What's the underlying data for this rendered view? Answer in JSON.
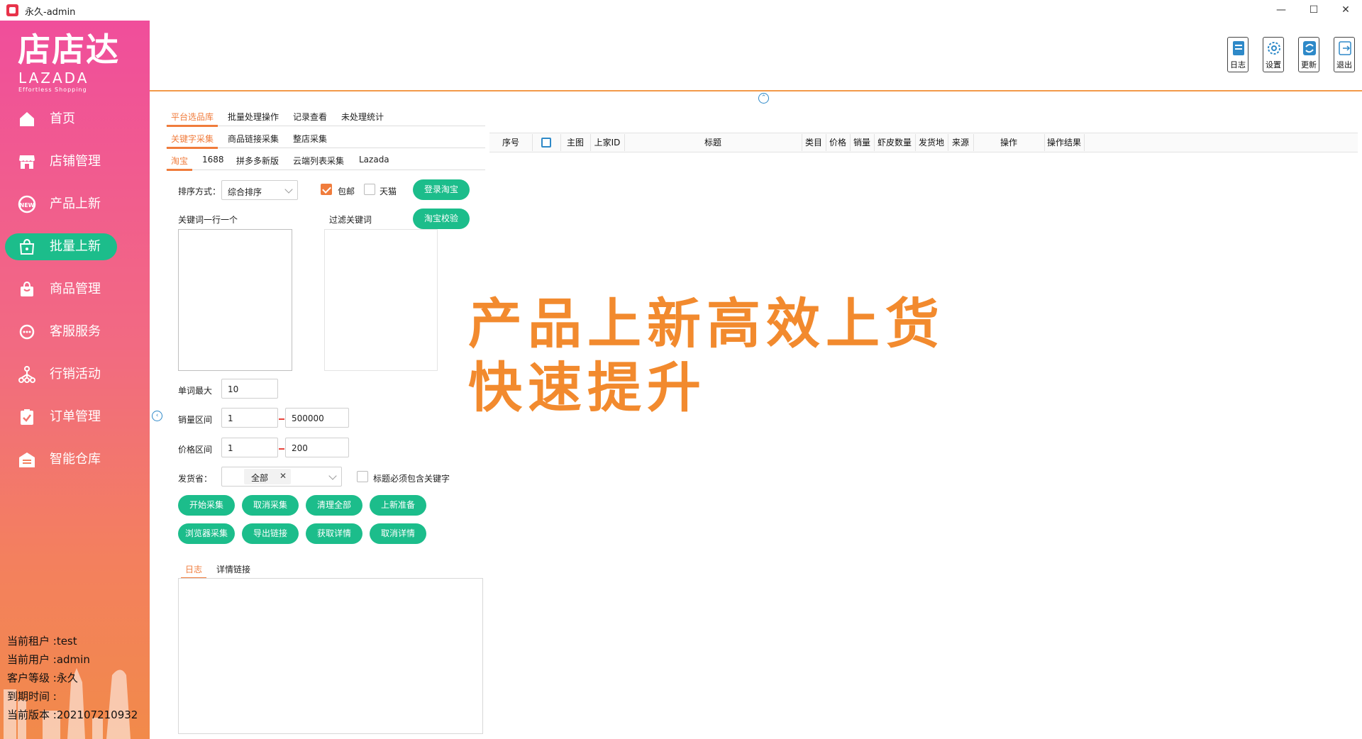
{
  "window": {
    "title": "永久-admin",
    "minimize": "—",
    "maximize": "☐",
    "close": "✕"
  },
  "brand": {
    "name": "店店达",
    "sub": "LAZADA",
    "tagline": "Effortless Shopping"
  },
  "sidebar": {
    "items": [
      {
        "label": "首页",
        "icon": "home-icon"
      },
      {
        "label": "店铺管理",
        "icon": "store-icon"
      },
      {
        "label": "产品上新",
        "icon": "new-badge-icon"
      },
      {
        "label": "批量上新",
        "icon": "bag-icon",
        "active": true
      },
      {
        "label": "商品管理",
        "icon": "shopping-bag-icon"
      },
      {
        "label": "客服服务",
        "icon": "support-icon"
      },
      {
        "label": "行销活动",
        "icon": "network-icon"
      },
      {
        "label": "订单管理",
        "icon": "clipboard-check-icon"
      },
      {
        "label": "智能仓库",
        "icon": "warehouse-icon"
      }
    ],
    "user": {
      "tenant": "当前租户 :test",
      "user": "当前用户 :admin",
      "level": "客户等级 :永久",
      "expiry": "到期时间 :",
      "version": "当前版本 :202107210932"
    }
  },
  "toolbar": {
    "log": "日志",
    "settings": "设置",
    "update": "更新",
    "logout": "退出"
  },
  "tabs": {
    "level1": [
      "平台选品库",
      "批量处理操作",
      "记录查看",
      "未处理统计"
    ],
    "level2": [
      "关键字采集",
      "商品链接采集",
      "整店采集"
    ],
    "level3": [
      "淘宝",
      "1688",
      "拼多多新版",
      "云端列表采集",
      "Lazada"
    ],
    "bottom": [
      "日志",
      "详情链接"
    ]
  },
  "form": {
    "sort_label": "排序方式：",
    "sort_value": "综合排序",
    "free_shipping": "包邮",
    "tmall": "天猫",
    "login_taobao": "登录淘宝",
    "keywords_label": "关键词一行一个",
    "filter_label": "过滤关键词",
    "taobao_verify": "淘宝校验",
    "max_label": "单词最大",
    "max_value": "10",
    "sales_label": "销量区间",
    "sales_min": "1",
    "sales_max": "500000",
    "price_label": "价格区间",
    "price_min": "1",
    "price_max": "200",
    "province_label": "发货省：",
    "province_value": "全部",
    "title_must": "标题必须包含关键字"
  },
  "buttons": {
    "row1": [
      "开始采集",
      "取消采集",
      "清理全部",
      "上新准备"
    ],
    "row2": [
      "浏览器采集",
      "导出链接",
      "获取详情",
      "取消详情"
    ]
  },
  "table": {
    "columns": [
      "序号",
      "",
      "主图",
      "上家ID",
      "标题",
      "类目",
      "价格",
      "销量",
      "虾皮数量",
      "发货地",
      "来源",
      "操作",
      "操作结果"
    ]
  },
  "promo": {
    "line1": "产品上新高效上货",
    "line2": "快速提升"
  },
  "colors": {
    "accent": "#f07c3c",
    "green": "#1cbd8b",
    "promo": "#f28a2e"
  }
}
